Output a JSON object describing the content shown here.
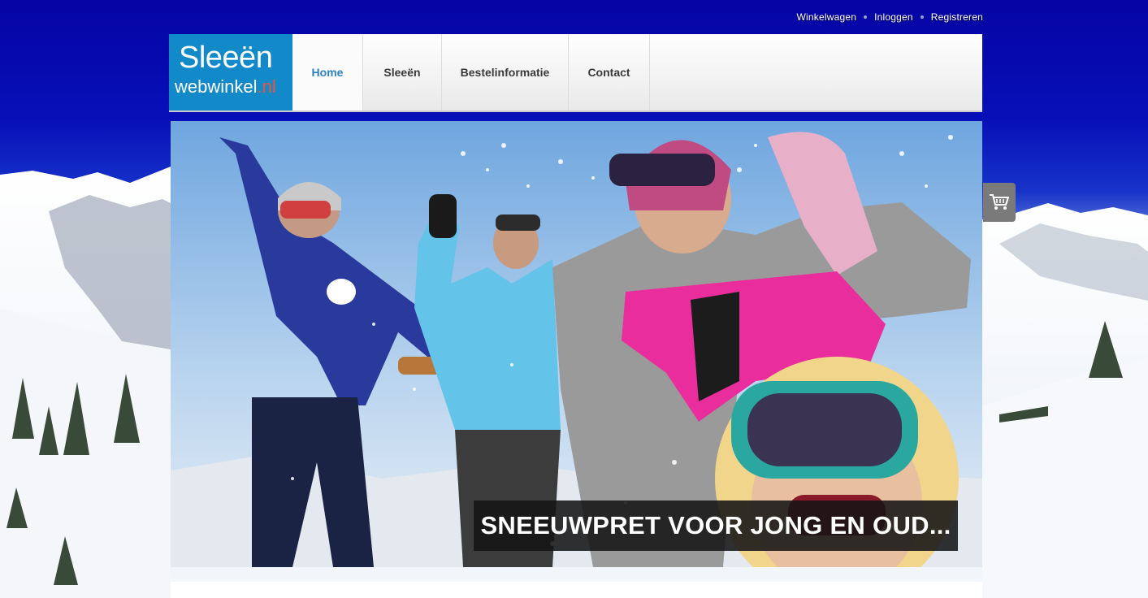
{
  "top_links": [
    "Winkelwagen",
    "Inloggen",
    "Registreren"
  ],
  "logo": {
    "line1": "Sleeën",
    "line2_main": "webwinkel",
    "line2_ext": ".nl"
  },
  "nav": [
    {
      "label": "Home",
      "active": true
    },
    {
      "label": "Sleeën",
      "active": false
    },
    {
      "label": "Bestelinformatie",
      "active": false
    },
    {
      "label": "Contact",
      "active": false
    }
  ],
  "hero": {
    "caption": "SNEEUWPRET VOOR JONG EN OUD..."
  },
  "cart": {
    "icon": "shopping-cart-icon"
  },
  "colors": {
    "logo_bg": "#1289c9",
    "nav_active": "#2b82bf",
    "sky_top": "#0504a4",
    "logo_ext": "#e8553e"
  }
}
